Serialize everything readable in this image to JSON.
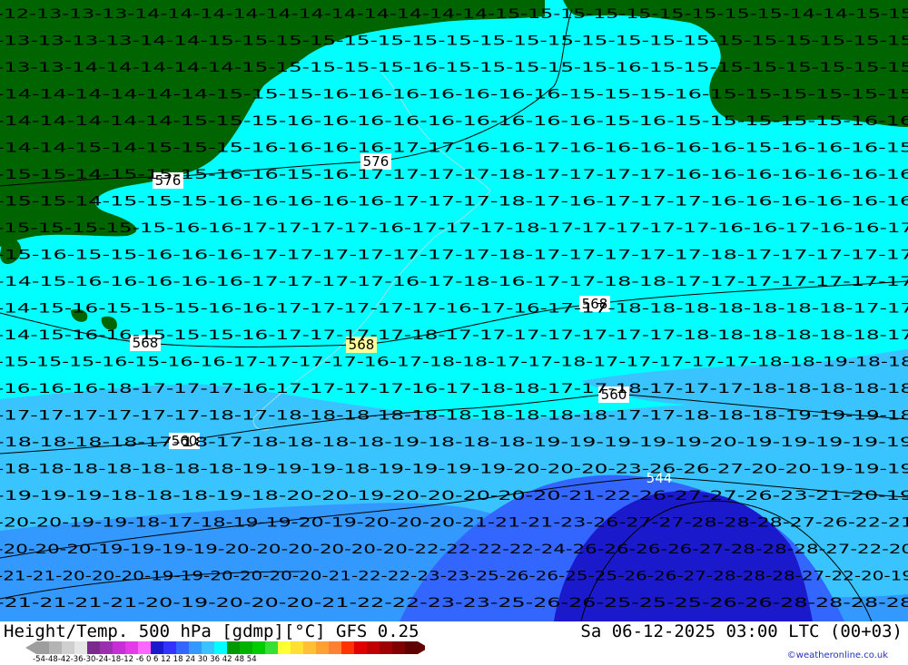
{
  "map": {
    "title": "Height/Temp. 500 hPa [gdmp][°C] GFS 0.25",
    "valid_time": "Sa 06-12-2025 03:00 LTC (00+03)",
    "credit": "©weatheronline.co.uk",
    "colors": {
      "land": "#006400",
      "temp_lt_minus16": "#00ffff",
      "temp_minus18": "#39c4ff",
      "temp_minus22": "#3399ff",
      "temp_minus26": "#3366ff",
      "temp_minus28": "#1a1acc"
    },
    "height_contours": [
      {
        "label": "576",
        "value": 576
      },
      {
        "label": "568",
        "value": 568
      },
      {
        "label": "560",
        "value": 560
      },
      {
        "label": "544",
        "value": 544
      }
    ],
    "height_label_text": [
      "576",
      "576",
      "568",
      "568",
      "568",
      "560",
      "560",
      "544"
    ],
    "temp_rows": [
      "-12-13-13-13-14-14-14-14-14-14-14-14-14-14-14-15-15-15-15-15-15-15-15-15-14-14-15-15",
      "-13-13-13-13-14-14-15-15-15-15-15-15-15-15-15-15-15-15-15-15-15-15-15-15-15-15-15",
      "-13-13-14-14-14-14-14-15-15-15-15-15-16-15-15-15-15-15-16-15-15-15-15-15-15-15-15",
      "-14-14-14-14-14-14-15-15-15-16-16-16-16-16-16-16-15-15-15-16-15-15-15-15-15-15",
      "-14-14-14-14-14-15-15-15-16-16-16-16-16-16-16-16-16-15-16-15-15-15-15-15-16-16",
      "-14-14-15-14-15-15-15-16-16-16-16-17-17-16-16-17-16-16-16-16-16-15-16-16-16-15",
      "-15-15-14-15-15-15-16-16-15-16-17-17-17-17-18-17-17-17-17-16-16-16-16-16-16-16",
      "-15-15-14-15-15-15-16-16-16-16-16-17-17-17-18-17-16-17-17-17-16-16-16-16-16-16",
      "-15-15-15-15-15-16-16-17-17-17-17-16-17-17-17-18-17-17-17-17-17-16-16-17-16-16-17",
      "-15-16-15-15-16-16-16-17-17-17-17-17-17-17-18-17-17-17-17-17-18-17-17-17-17-17",
      "-14-15-16-16-16-16-16-17-17-17-17-16-17-18-16-17-17-18-18-17-17-17-17-17-17-17",
      "-14-15-16-15-15-15-16-16-17-17-17-17-17-16-17-16-17-17-18-18-18-18-18-18-18-17-17",
      "-14-15-16-16-15-15-15-16-17-17-17-17-18-17-17-17-17-17-17-17-18-18-18-18-18-18-17",
      "-15-15-15-16-15-16-16-17-17-17-17-16-17-18-18-17-17-18-17-17-17-17-17-18-18-19-18-18",
      "-16-16-16-18-17-17-17-16-17-17-17-17-16-17-18-18-17-17-18-17-17-17-18-18-18-18-18",
      "-17-17-17-17-17-17-18-17-18-18-18-18-18-18-18-18-18-18-17-17-18-18-18-19-19-19-18",
      "-18-18-18-18-17-18-17-18-18-18-18-19-18-18-18-19-19-19-19-19-20-19-19-19-19-19",
      "-18-18-18-18-18-18-18-19-19-19-18-19-19-19-19-20-20-20-23-26-26-27-20-20-19-19-19",
      "-19-19-19-18-18-18-19-18-20-20-19-20-20-20-20-20-21-22-26-27-27-26-23-21-20-19",
      "-20-20-19-19-18-17-18-19-19-20-19-20-20-20-21-21-21-23-26-27-27-28-28-28-27-26-22-21",
      "-20-20-20-19-19-19-19-20-20-20-20-20-20-22-22-22-22-24-26-26-26-26-27-28-28-28-27-22-20",
      "-21-21-20-20-20-19-19-20-20-20-20-21-22-22-23-23-25-26-26-25-25-26-26-27-28-28-28-27-22-20-19",
      "-21-21-21-21-20-19-20-20-20-21-22-22-23-23-25-26-26-25-25-25-26-26-28-28-28-28"
    ]
  },
  "colorbar": {
    "ticks": "-54-48-42-36-30-24-18-12 -6  0  6  12 18 24 30 36 42 48 54",
    "colors": [
      "#9e9e9e",
      "#b4b4b4",
      "#cfcfcf",
      "#e6e6e6",
      "#7a2a8c",
      "#9b2fb0",
      "#c62fd6",
      "#e33be8",
      "#ff66ff",
      "#1a1acc",
      "#3333ff",
      "#3366ff",
      "#3399ff",
      "#39c4ff",
      "#00ffff",
      "#009900",
      "#00b200",
      "#00cc00",
      "#33e033",
      "#ffff33",
      "#ffe033",
      "#ffc033",
      "#ffa033",
      "#ff8033",
      "#ff3300",
      "#e00000",
      "#c00000",
      "#a00000",
      "#800000",
      "#600000"
    ]
  }
}
